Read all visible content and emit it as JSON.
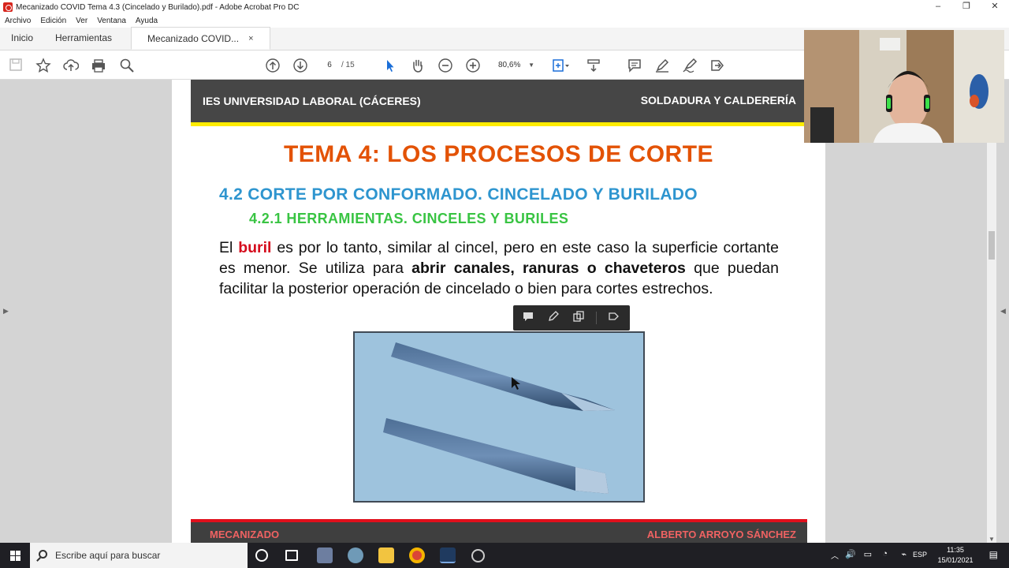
{
  "window": {
    "title": "Mecanizado COVID Tema 4.3 (Cincelado y Burilado).pdf - Adobe Acrobat Pro DC",
    "controls": [
      "–",
      "❐",
      "✕"
    ]
  },
  "menu": [
    "Archivo",
    "Edición",
    "Ver",
    "Ventana",
    "Ayuda"
  ],
  "tabs": {
    "home": "Inicio",
    "tools": "Herramientas",
    "document": "Mecanizado COVID...",
    "close": "×"
  },
  "toolbar": {
    "current_page": "6",
    "total_pages": "/ 15",
    "zoom": "80,6%"
  },
  "page": {
    "header_left": "IES UNIVERSIDAD LABORAL (CÁCERES)",
    "header_right": "SOLDADURA Y CALDERERÍA",
    "title": "TEMA 4: LOS PROCESOS DE CORTE",
    "subtitle1": "4.2 CORTE POR CONFORMADO. CINCELADO Y BURILADO",
    "subtitle2": "4.2.1 HERRAMIENTAS. CINCELES Y BURILES",
    "body": {
      "p1": "El ",
      "highlight_red": "buril",
      "p2": " es por lo tanto, similar al cincel, pero en este caso la superficie cortante es menor. Se utiliza para ",
      "highlight_bold": "abrir canales, ranuras o chaveteros",
      "p3": " que puedan facilitar la posterior operación de cincelado o bien para cortes estrechos."
    },
    "footer_left": "MECANIZADO",
    "footer_right": "ALBERTO ARROYO SÁNCHEZ"
  },
  "taskbar": {
    "search_placeholder": "Escribe aquí para buscar",
    "language": "ESP",
    "time": "11:35",
    "date": "15/01/2021"
  },
  "colors": {
    "title": "#e35205",
    "subtitle1": "#2e95cf",
    "subtitle2": "#39c443",
    "highlight": "#d50c1d",
    "header_bar": "#464646",
    "header_accent": "#ffec00",
    "footer_accent": "#e0101c"
  }
}
